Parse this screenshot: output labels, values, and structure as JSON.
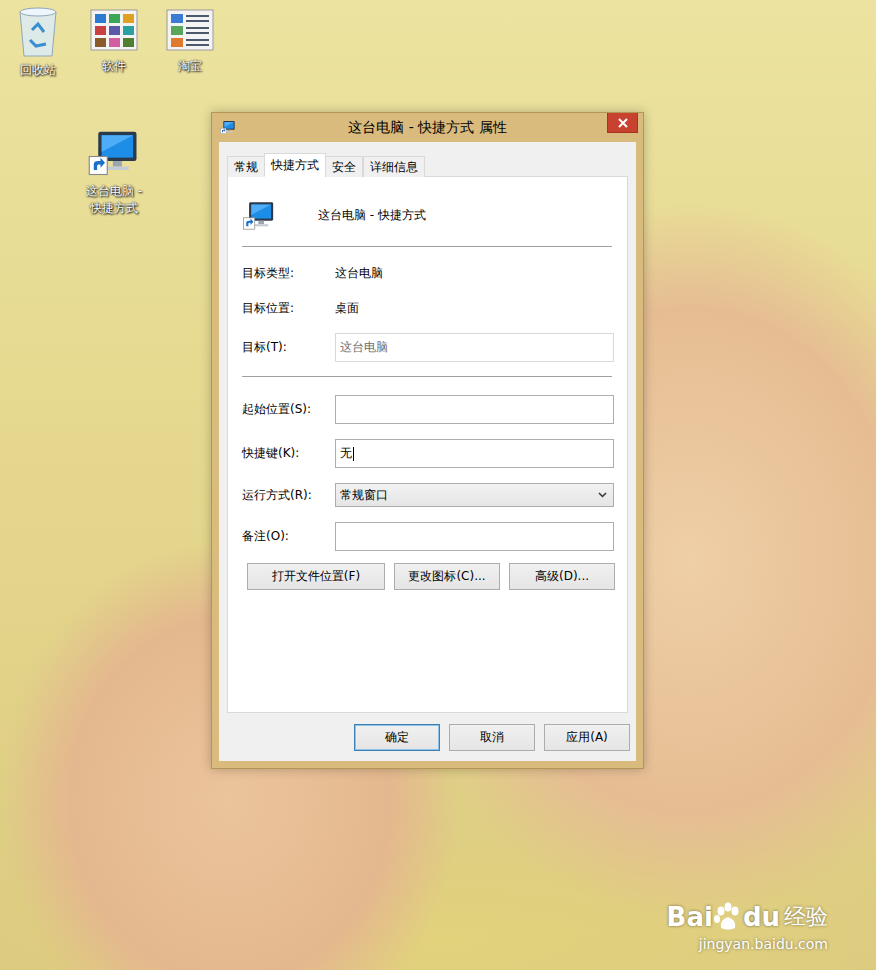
{
  "desktop_icons": [
    {
      "label": "回收站",
      "kind": "recycle"
    },
    {
      "label": "软件",
      "kind": "grid"
    },
    {
      "label": "淘宝",
      "kind": "list"
    },
    {
      "label": "这台电脑 - 快捷方式",
      "kind": "computer"
    }
  ],
  "window": {
    "title": "这台电脑 - 快捷方式 属性"
  },
  "tabs": [
    {
      "label": "常规",
      "selected": false
    },
    {
      "label": "快捷方式",
      "selected": true
    },
    {
      "label": "安全",
      "selected": false
    },
    {
      "label": "详细信息",
      "selected": false
    }
  ],
  "header": {
    "name": "这台电脑 - 快捷方式"
  },
  "info_rows": [
    {
      "label": "目标类型:",
      "value": "这台电脑"
    },
    {
      "label": "目标位置:",
      "value": "桌面"
    }
  ],
  "target_field": {
    "label": "目标(T):",
    "value": "这台电脑",
    "disabled": true
  },
  "fields": [
    {
      "label": "起始位置(S):",
      "value": "",
      "kind": "text",
      "focused": false
    },
    {
      "label": "快捷键(K):",
      "value": "无",
      "kind": "text",
      "focused": true
    },
    {
      "label": "运行方式(R):",
      "value": "常规窗口",
      "kind": "select",
      "focused": false
    },
    {
      "label": "备注(O):",
      "value": "",
      "kind": "text",
      "focused": false
    }
  ],
  "action_buttons": [
    "打开文件位置(F)",
    "更改图标(C)...",
    "高级(D)..."
  ],
  "dialog_buttons": [
    {
      "label": "确定",
      "default": true
    },
    {
      "label": "取消",
      "default": false
    },
    {
      "label": "应用(A)",
      "default": false
    }
  ],
  "watermark": {
    "brand_left": "Bai",
    "brand_right": "du",
    "brand_cn": "经验",
    "url": "jingyan.baidu.com"
  }
}
